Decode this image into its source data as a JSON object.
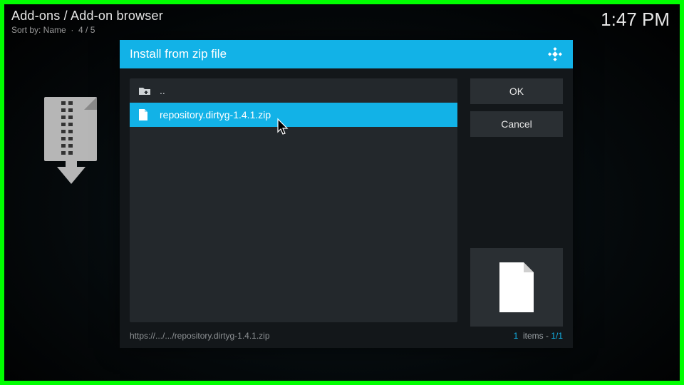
{
  "header": {
    "breadcrumb": "Add-ons / Add-on browser",
    "sort_label": "Sort by: Name",
    "position": "4 / 5",
    "clock": "1:47 PM"
  },
  "dialog": {
    "title": "Install from zip file",
    "buttons": {
      "ok": "OK",
      "cancel": "Cancel"
    },
    "rows": {
      "up": "..",
      "file": "repository.dirtyg-1.4.1.zip"
    },
    "footer": {
      "path": "https://.../.../repository.dirtyg-1.4.1.zip",
      "items_label": "items",
      "count": "1",
      "page": "1/1"
    }
  }
}
